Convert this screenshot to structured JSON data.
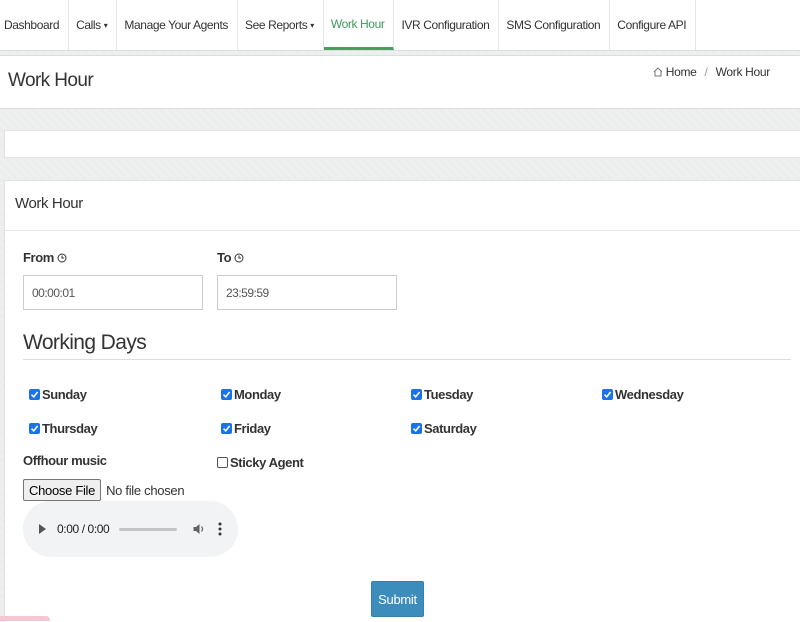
{
  "nav": {
    "items": [
      {
        "label": "Dashboard"
      },
      {
        "label": "Calls",
        "caret": "▾"
      },
      {
        "label": "Manage Your Agents"
      },
      {
        "label": "See Reports",
        "caret": "▾"
      },
      {
        "label": "Work Hour",
        "active": true
      },
      {
        "label": "IVR Configuration"
      },
      {
        "label": "SMS Configuration"
      },
      {
        "label": "Configure API"
      }
    ]
  },
  "header": {
    "title": "Work Hour",
    "breadcrumb": {
      "home": "Home",
      "current": "Work Hour"
    }
  },
  "panel": {
    "title": "Work Hour",
    "from_label": "From",
    "to_label": "To",
    "from_value": "00:00:01",
    "to_value": "23:59:59",
    "working_days_heading": "Working Days",
    "days": [
      {
        "label": "Sunday",
        "checked": true
      },
      {
        "label": "Monday",
        "checked": true
      },
      {
        "label": "Tuesday",
        "checked": true
      },
      {
        "label": "Wednesday",
        "checked": true
      },
      {
        "label": "Thursday",
        "checked": true
      },
      {
        "label": "Friday",
        "checked": true
      },
      {
        "label": "Saturday",
        "checked": true
      }
    ],
    "offhour_label": "Offhour music",
    "sticky_agent": {
      "label": "Sticky Agent",
      "checked": false
    },
    "file_button": "Choose File",
    "file_status": "No file chosen",
    "audio_time": "0:00 / 0:00",
    "submit_label": "Submit"
  },
  "colors": {
    "active_nav": "#3c9a5f",
    "checkbox": "#1a73e8",
    "submit": "#3c8dbc"
  },
  "icons": {
    "home": "home-icon",
    "clock": "clock-icon",
    "check": "check-icon",
    "play": "play-icon",
    "volume": "volume-icon",
    "more": "more-vertical-icon"
  }
}
